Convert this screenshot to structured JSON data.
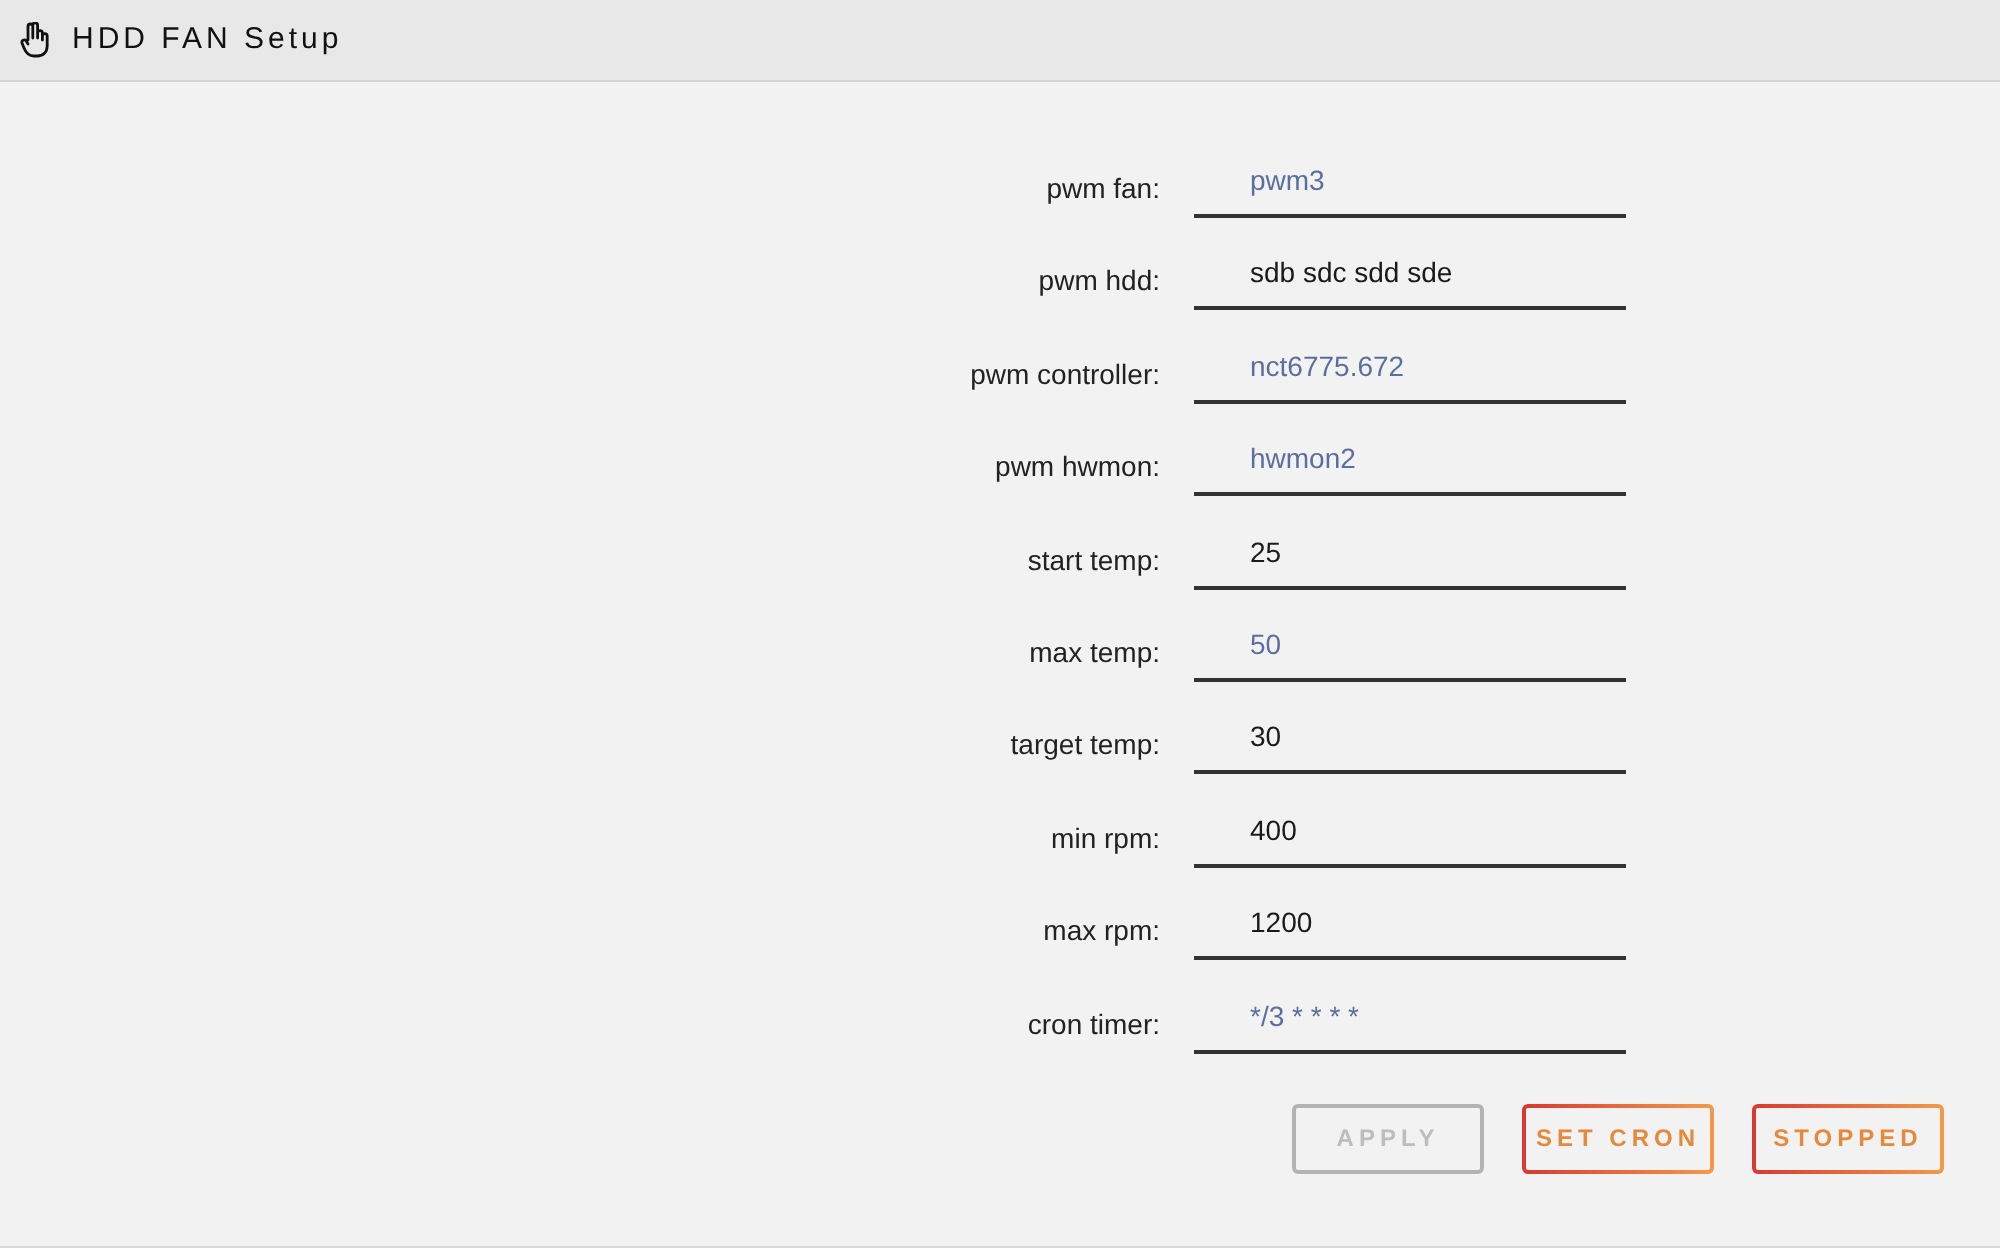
{
  "window": {
    "title": "HDD FAN Setup"
  },
  "fields": [
    {
      "label": "pwm fan:",
      "value": "pwm3",
      "kind": "select"
    },
    {
      "label": "pwm hdd:",
      "value": "sdb sdc sdd sde",
      "kind": "input"
    },
    {
      "label": "pwm controller:",
      "value": "nct6775.672",
      "kind": "select"
    },
    {
      "label": "pwm hwmon:",
      "value": "hwmon2",
      "kind": "select"
    },
    {
      "label": "start temp:",
      "value": "25",
      "kind": "input"
    },
    {
      "label": "max temp:",
      "value": "50",
      "kind": "select"
    },
    {
      "label": "target temp:",
      "value": "30",
      "kind": "input"
    },
    {
      "label": "min rpm:",
      "value": "400",
      "kind": "input"
    },
    {
      "label": "max rpm:",
      "value": "1200",
      "kind": "input"
    },
    {
      "label": "cron timer:",
      "value": "*/3 * * * *",
      "kind": "select"
    }
  ],
  "buttons": [
    {
      "label": "APPLY",
      "disabled": true
    },
    {
      "label": "SET CRON",
      "disabled": false
    },
    {
      "label": "STOPPED",
      "disabled": false
    }
  ]
}
